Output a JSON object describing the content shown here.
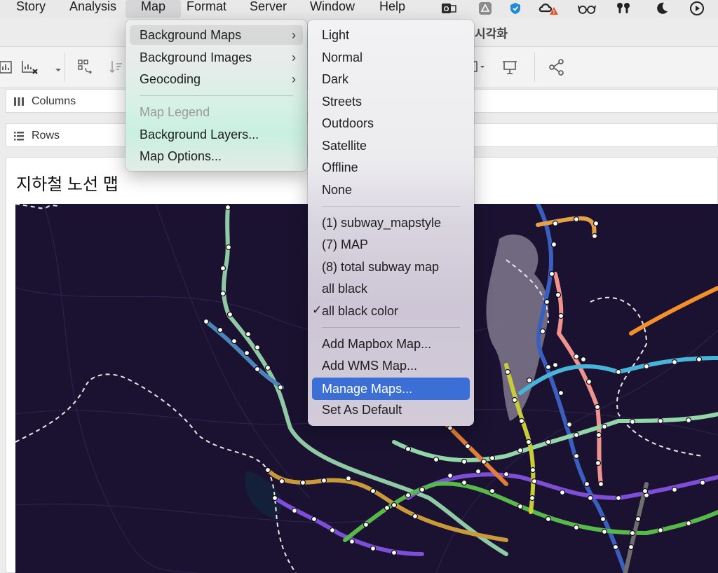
{
  "menubar": {
    "items": [
      "Story",
      "Analysis",
      "Map",
      "Format",
      "Server",
      "Window",
      "Help"
    ],
    "open_item": "Map"
  },
  "window": {
    "title": "시각화"
  },
  "shelves": {
    "columns": "Columns",
    "rows": "Rows"
  },
  "sheet": {
    "title": "지하철 노선 맵"
  },
  "map_menu": {
    "items": [
      {
        "label": "Background Maps",
        "submenu": true,
        "enabled": true,
        "highlighted": true
      },
      {
        "label": "Background Images",
        "submenu": true,
        "enabled": true
      },
      {
        "label": "Geocoding",
        "submenu": true,
        "enabled": true
      },
      {
        "label": "Map Legend",
        "submenu": false,
        "enabled": false
      },
      {
        "label": "Background Layers...",
        "submenu": false,
        "enabled": true
      },
      {
        "label": "Map Options...",
        "submenu": false,
        "enabled": true
      }
    ]
  },
  "background_maps_submenu": {
    "styles": [
      "Light",
      "Normal",
      "Dark",
      "Streets",
      "Outdoors",
      "Satellite",
      "Offline",
      "None"
    ],
    "saved": [
      "(1) subway_mapstyle",
      "(7) MAP",
      "(8) total subway map",
      "all black",
      "all black color"
    ],
    "checked": "all black color",
    "actions": [
      "Add Mapbox Map...",
      "Add WMS Map...",
      "Manage Maps...",
      "Set As Default"
    ],
    "highlighted": "Manage Maps..."
  },
  "icons": {
    "tray": [
      "outlook-icon",
      "drive-icon",
      "shield-icon",
      "creative-cloud-alert-icon",
      "glasses-icon",
      "airpods-icon",
      "moon-icon",
      "play-circle-icon"
    ],
    "toolbar": [
      "chart-icon",
      "clear-sheet-icon",
      "swap-icon",
      "sort-icon",
      "dropdown-icon",
      "presentation-icon",
      "share-icon"
    ]
  },
  "colors": {
    "highlight": "#3b6fd6",
    "map_background": "#1a1230"
  }
}
